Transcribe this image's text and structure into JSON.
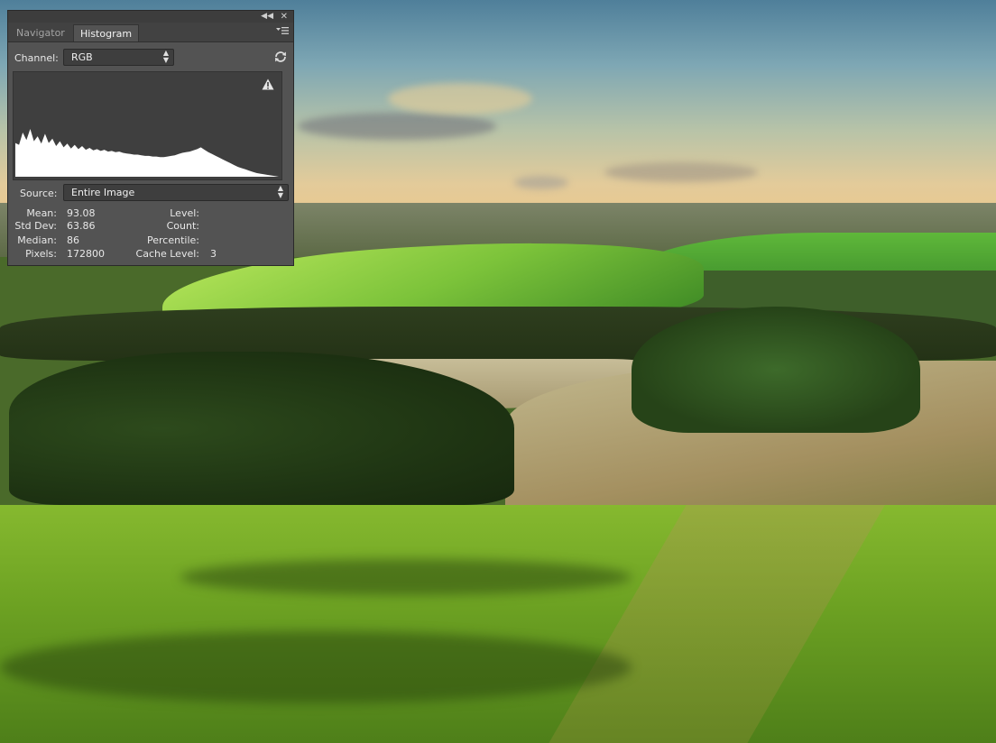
{
  "panel": {
    "tabs": [
      {
        "label": "Navigator",
        "active": false
      },
      {
        "label": "Histogram",
        "active": true
      }
    ],
    "channel": {
      "label": "Channel:",
      "value": "RGB"
    },
    "source": {
      "label": "Source:",
      "value": "Entire Image"
    },
    "stats_left": [
      {
        "label": "Mean:",
        "value": "93.08"
      },
      {
        "label": "Std Dev:",
        "value": "63.86"
      },
      {
        "label": "Median:",
        "value": "86"
      },
      {
        "label": "Pixels:",
        "value": "172800"
      }
    ],
    "stats_right": [
      {
        "label": "Level:",
        "value": ""
      },
      {
        "label": "Count:",
        "value": ""
      },
      {
        "label": "Percentile:",
        "value": ""
      },
      {
        "label": "Cache Level:",
        "value": "3"
      }
    ],
    "icons": [
      "collapse-icon",
      "close-icon",
      "panel-menu-icon",
      "refresh-icon",
      "warning-icon"
    ],
    "colors": {
      "panel_bg": "#535353",
      "histogram_fill": "#ffffff",
      "histogram_bg": "#3f3f3f"
    }
  },
  "histogram_data": {
    "type": "area",
    "x_range": [
      0,
      255
    ],
    "y_range": [
      0,
      1
    ],
    "values": [
      0.55,
      0.52,
      0.72,
      0.6,
      0.78,
      0.58,
      0.66,
      0.54,
      0.7,
      0.55,
      0.62,
      0.5,
      0.58,
      0.48,
      0.54,
      0.46,
      0.52,
      0.45,
      0.5,
      0.44,
      0.47,
      0.43,
      0.45,
      0.42,
      0.44,
      0.41,
      0.42,
      0.4,
      0.41,
      0.39,
      0.38,
      0.37,
      0.36,
      0.36,
      0.35,
      0.34,
      0.34,
      0.33,
      0.33,
      0.32,
      0.32,
      0.33,
      0.34,
      0.35,
      0.37,
      0.39,
      0.4,
      0.41,
      0.43,
      0.45,
      0.48,
      0.44,
      0.4,
      0.37,
      0.34,
      0.31,
      0.28,
      0.25,
      0.22,
      0.19,
      0.16,
      0.14,
      0.12,
      0.1,
      0.08,
      0.06,
      0.05,
      0.04,
      0.03,
      0.02,
      0.01,
      0.0
    ]
  }
}
